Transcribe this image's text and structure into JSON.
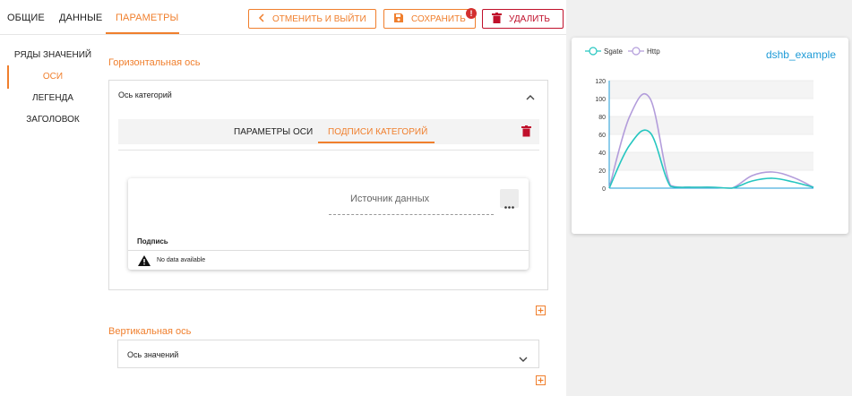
{
  "top_tabs": [
    "ОБЩИЕ",
    "ДАННЫЕ",
    "ПАРАМЕТРЫ"
  ],
  "toolbar": {
    "cancel_label": "ОТМЕНИТЬ И ВЫЙТИ",
    "save_label": "СОХРАНИТЬ",
    "save_badge": "!",
    "delete_label": "УДАЛИТЬ"
  },
  "sidebar": {
    "items": [
      {
        "label": "РЯДЫ ЗНАЧЕНИЙ"
      },
      {
        "label": "ОСИ"
      },
      {
        "label": "ЛЕГЕНДА"
      },
      {
        "label": "ЗАГОЛОВОК"
      }
    ]
  },
  "horizontal": {
    "section_title": "Горизонтальная ось",
    "panel_title": "Ось категорий",
    "tabs": [
      "ПАРАМЕТРЫ ОСИ",
      "ПОДПИСИ КАТЕГОРИЙ"
    ],
    "source_label": "Источник данных",
    "column_header": "Подпись",
    "empty_text": "No data available"
  },
  "vertical": {
    "section_title": "Вертикальная ось",
    "panel_title": "Ось значений"
  },
  "chart": {
    "title": "dshb_example",
    "colors": {
      "Sgate": "#26c6c0",
      "Http": "#b39ddb"
    }
  },
  "chart_data": {
    "type": "line",
    "title": "dshb_example",
    "ylim": [
      0,
      120
    ],
    "yticks": [
      "0",
      "20",
      "40",
      "60",
      "80",
      "100",
      "120"
    ],
    "grid": true,
    "legend": "top-left",
    "x": [
      0,
      1,
      2,
      3,
      4,
      5,
      6,
      7,
      8,
      9,
      10
    ],
    "series": [
      {
        "name": "Sgate",
        "values": [
          0,
          48,
          62,
          2,
          1,
          1,
          0,
          8,
          11,
          7,
          1
        ]
      },
      {
        "name": "Http",
        "values": [
          0,
          80,
          100,
          3,
          1,
          1,
          0,
          14,
          18,
          12,
          1
        ]
      }
    ]
  }
}
